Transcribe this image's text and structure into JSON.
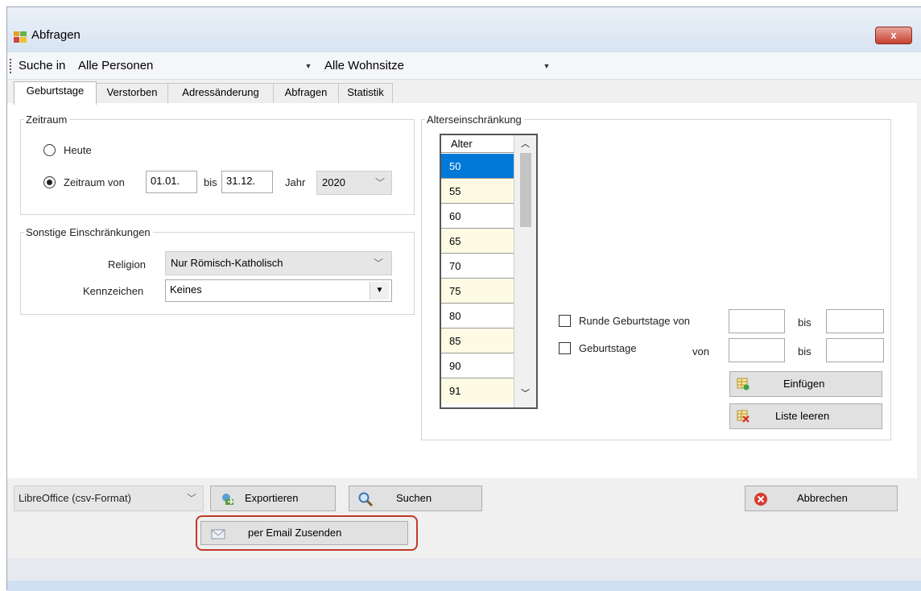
{
  "window": {
    "title": "Abfragen",
    "close_label": "x"
  },
  "toolbar": {
    "suche_label": "Suche in",
    "personen_value": "Alle Personen",
    "wohnsitze_value": "Alle Wohnsitze"
  },
  "tabs": [
    {
      "label": "Geburtstage",
      "active": true
    },
    {
      "label": "Verstorben",
      "active": false
    },
    {
      "label": "Adressänderung",
      "active": false
    },
    {
      "label": "Abfragen",
      "active": false
    },
    {
      "label": "Statistik",
      "active": false
    }
  ],
  "zeitraum": {
    "legend": "Zeitraum",
    "heute_label": "Heute",
    "zeitraum_von_label": "Zeitraum von",
    "von_value": "01.01.",
    "bis_label": "bis",
    "bis_value": "31.12.",
    "jahr_label": "Jahr",
    "jahr_value": "2020",
    "selected": "zeitraum"
  },
  "sonstige": {
    "legend": "Sonstige Einschränkungen",
    "religion_label": "Religion",
    "religion_value": "Nur Römisch-Katholisch",
    "kennzeichen_label": "Kennzeichen",
    "kennzeichen_value": "Keines"
  },
  "alter": {
    "legend": "Alterseinschränkung",
    "header": "Alter",
    "values": [
      "50",
      "55",
      "60",
      "65",
      "70",
      "75",
      "80",
      "85",
      "90",
      "91"
    ],
    "selected_index": 0,
    "runde_label": "Runde Geburtstage von",
    "geburtstage_label": "Geburtstage",
    "von_label": "von",
    "bis_label": "bis",
    "einfuegen_label": "Einfügen",
    "liste_leeren_label": "Liste leeren"
  },
  "bottom": {
    "export_format": "LibreOffice (csv-Format)",
    "exportieren_label": "Exportieren",
    "suchen_label": "Suchen",
    "abbrechen_label": "Abbrechen",
    "email_label": "per Email Zusenden"
  },
  "colors": {
    "selected_row": "#0078d7",
    "alt_row": "#fdfbe3",
    "highlight": "#c0392b"
  }
}
